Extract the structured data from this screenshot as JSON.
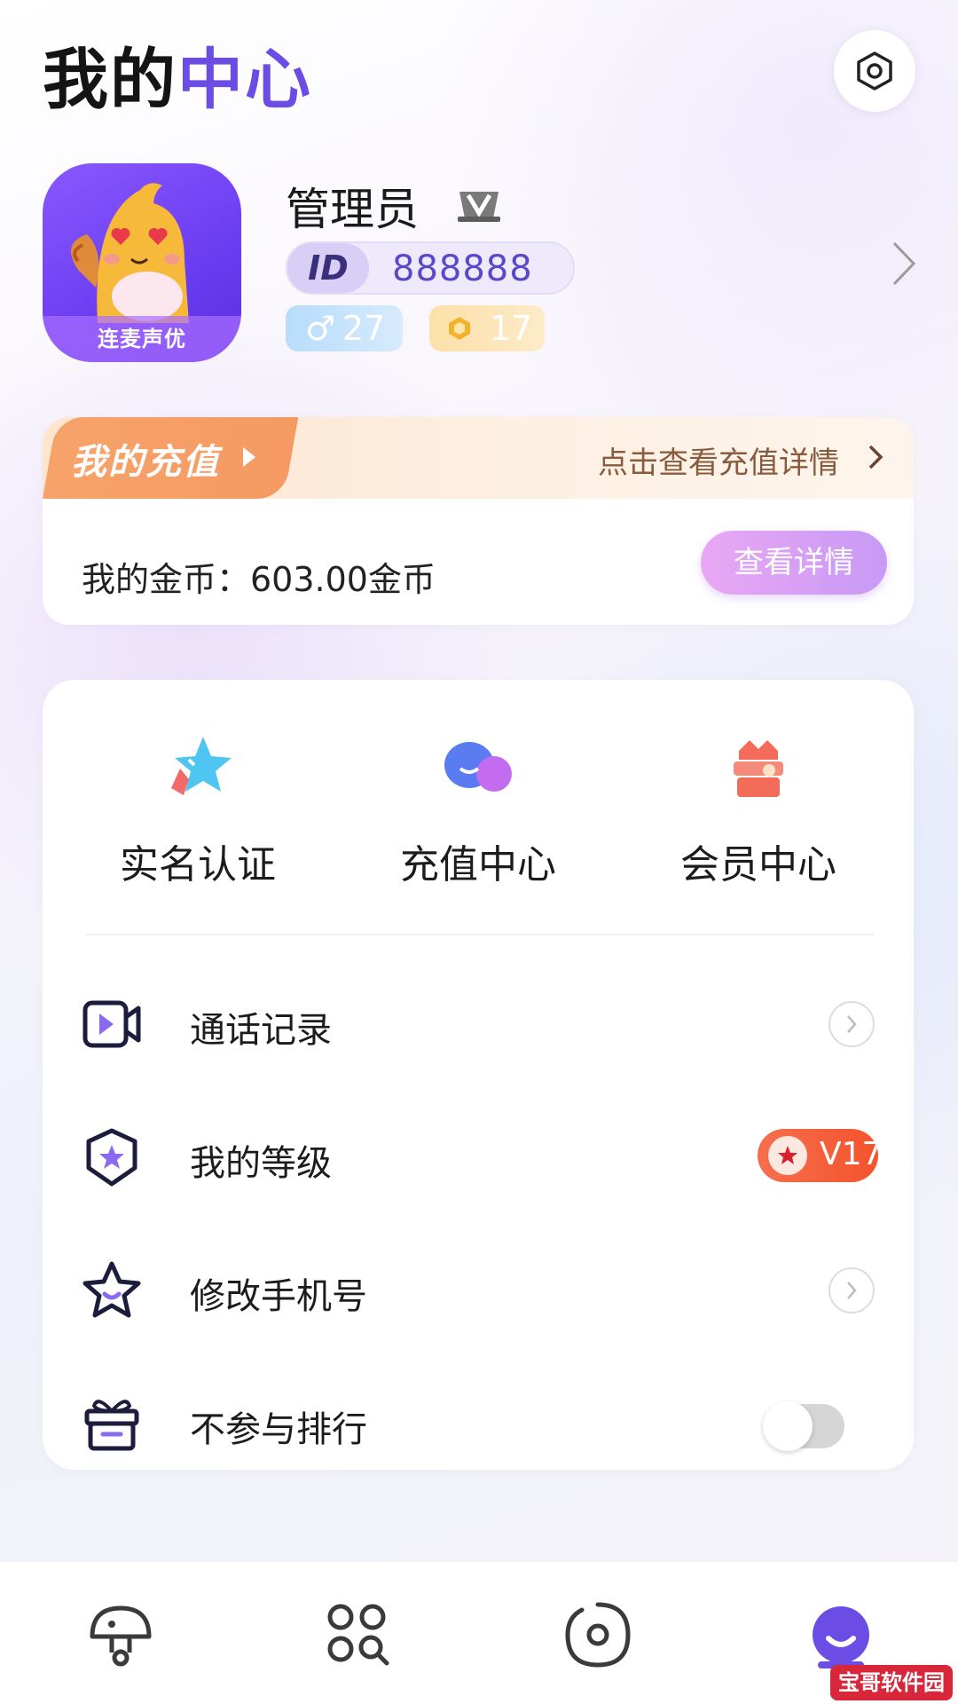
{
  "header": {
    "title_part1": "我的",
    "title_part2": "中心",
    "settings_icon": "settings-hexagon-icon"
  },
  "profile": {
    "username": "管理员",
    "avatar_caption": "连麦声优",
    "id_label": "ID",
    "id_value": "888888",
    "gender_symbol": "♂",
    "age": "27",
    "coin_level": "17"
  },
  "recharge": {
    "tab_label": "我的充值",
    "link_text": "点击查看充值详情",
    "coins_text": "我的金币：603.00金币",
    "detail_button": "查看详情"
  },
  "quick_actions": [
    {
      "label": "实名认证",
      "icon": "star-verify-icon"
    },
    {
      "label": "充值中心",
      "icon": "chat-bubbles-icon"
    },
    {
      "label": "会员中心",
      "icon": "gift-crown-icon"
    }
  ],
  "menu": [
    {
      "label": "通话记录",
      "icon": "video-call-icon"
    },
    {
      "label": "我的等级",
      "icon": "level-star-badge-icon",
      "badge": "V17"
    },
    {
      "label": "修改手机号",
      "icon": "star-smile-icon"
    },
    {
      "label": "不参与排行",
      "icon": "gift-box-icon",
      "toggle": false
    }
  ],
  "bottom_nav": [
    {
      "icon": "mushroom-home-icon",
      "active": false
    },
    {
      "icon": "grid-search-icon",
      "active": false
    },
    {
      "icon": "disc-icon",
      "active": false
    },
    {
      "icon": "smile-profile-icon",
      "active": true
    }
  ],
  "watermark": "宝哥软件园",
  "colors": {
    "accent": "#6b4de6",
    "recharge_orange": "#f59a63",
    "detail_button": "#d9a0f5",
    "level_badge": "#f4532d"
  }
}
